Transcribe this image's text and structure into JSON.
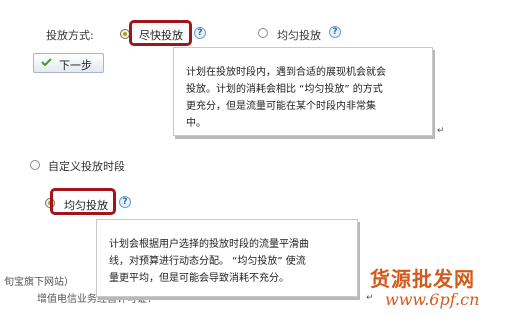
{
  "form": {
    "mode_label": "投放方式:",
    "option_fast": "尽快投放",
    "option_even": "均匀投放",
    "next_label": "下一步",
    "custom_time_label": "自定义投放时段",
    "custom_even_label": "均匀投放"
  },
  "tooltip1": {
    "lines": [
      "计划在投放时段内，遇到合适的展现机会就会",
      "投放。计划的消耗会相比 “均匀投放” 的方式",
      "更充分，但是流量可能在某个时段内非常集",
      "中。"
    ]
  },
  "tooltip2": {
    "lines": [
      "计划会根据用户选择的投放时段的流量平滑曲",
      "线，对预算进行动态分配。 “均匀投放” 使流",
      "量更平均，但是可能会导致消耗不充分。"
    ]
  },
  "footer": {
    "line1": "旬宝旗下网站）",
    "line2": "增值电信业务经营许可证：",
    "paragraph_mark": "↵"
  },
  "watermark": {
    "text1": "货源批发网",
    "text2": "www.6pf.cn"
  },
  "colors": {
    "highlight": "#a1141a",
    "radio_dot": "#b1a013",
    "watermark": "#d45a1c"
  }
}
